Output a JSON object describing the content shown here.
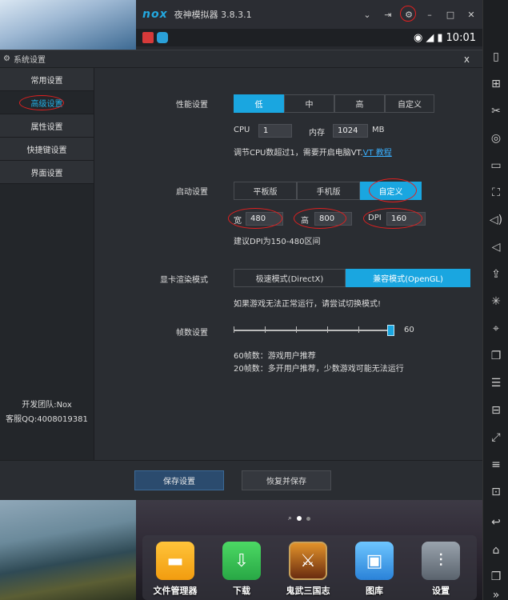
{
  "window": {
    "logo": "nox",
    "title": "夜神模拟器 3.8.3.1",
    "controls": [
      "chevron-down-icon",
      "pin-icon",
      "gear-icon",
      "minimize-icon",
      "maximize-icon",
      "close-icon"
    ],
    "time": "10:01"
  },
  "dialog": {
    "title": "系统设置",
    "close": "x",
    "nav": [
      "常用设置",
      "高级设置",
      "属性设置",
      "快捷键设置",
      "界面设置"
    ],
    "active_nav": 1,
    "team": "开发团队:Nox",
    "qq": "客服QQ:4008019381"
  },
  "performance": {
    "label": "性能设置",
    "options": [
      "低",
      "中",
      "高",
      "自定义"
    ],
    "selected": 0,
    "cpu_label": "CPU",
    "cpu_value": "1",
    "mem_label": "内存",
    "mem_value": "1024",
    "mem_unit": "MB",
    "hint": "调节CPU数超过1，需要开启电脑VT.",
    "hint_link": "VT 教程"
  },
  "startup": {
    "label": "启动设置",
    "options": [
      "平板版",
      "手机版",
      "自定义"
    ],
    "selected": 2,
    "width_label": "宽",
    "width_value": "480",
    "height_label": "高",
    "height_value": "800",
    "dpi_label": "DPI",
    "dpi_value": "160",
    "hint": "建议DPI为150-480区间"
  },
  "render": {
    "label": "显卡渲染模式",
    "options": [
      "极速模式(DirectX)",
      "兼容模式(OpenGL)"
    ],
    "selected": 1,
    "hint": "如果游戏无法正常运行，请尝试切换模式!"
  },
  "fps": {
    "label": "帧数设置",
    "value": "60",
    "level": 1.0,
    "note1": "60帧数：游戏用户推荐",
    "note2": "20帧数：多开用户推荐，少数游戏可能无法运行"
  },
  "footer": {
    "save": "保存设置",
    "restore": "恢复并保存"
  },
  "dock": {
    "page_indicator": [
      "search",
      "current",
      "other"
    ],
    "apps": [
      "文件管理器",
      "下载",
      "鬼武三国志",
      "图库",
      "设置"
    ]
  },
  "colors": {
    "accent": "#1aa6e0",
    "annotation": "#e02020",
    "dialog_bg": "#2a2d32"
  }
}
